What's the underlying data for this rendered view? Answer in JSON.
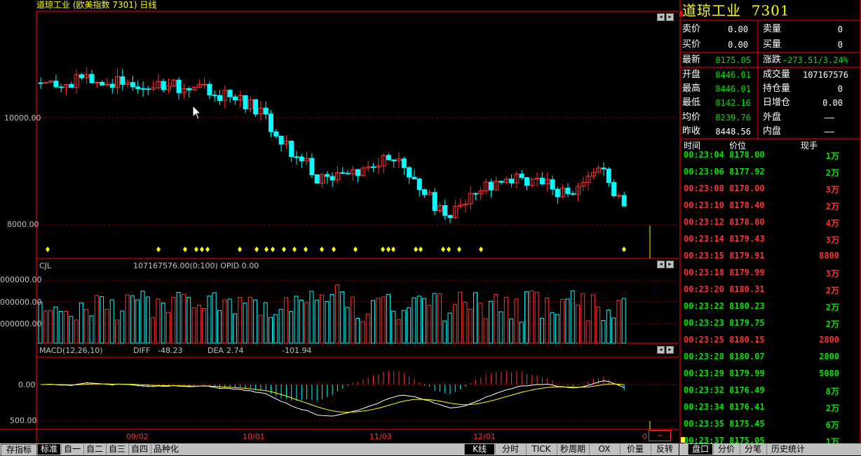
{
  "title": "道琼工业 (欧美指数  7301) 日线",
  "main": {
    "price_labels": [
      "10000.00",
      "8000.00"
    ],
    "date_labels": [
      "09/02",
      "10/01",
      "11/03",
      "12/01",
      "0"
    ]
  },
  "cjl": {
    "label": "CJL",
    "info": "107167576.00(0:100) OPID   0.00",
    "axis_labels": [
      "000000.00",
      "000000.00",
      "000000.00"
    ]
  },
  "macd": {
    "label": "MACD(12,26,10)",
    "diff_label": "DIFF",
    "diff_value": "-48.23",
    "dea_label": "DEA",
    "dea_value": "2.74",
    "macd_value": "-101.94",
    "axis_labels": [
      "0.00",
      "500.00"
    ]
  },
  "quote": {
    "name": "道琼工业",
    "code": "7301",
    "sell_price_label": "卖价",
    "sell_price": "0.00",
    "sell_vol_label": "卖量",
    "sell_vol": "0",
    "buy_price_label": "买价",
    "buy_price": "0.00",
    "buy_vol_label": "买量",
    "buy_vol": "0",
    "last_label": "最新",
    "last": "8175.05",
    "change_label": "涨跌",
    "change": "-273.51/3.24%",
    "open_label": "开盘",
    "open": "8446.01",
    "volume_label": "成交量",
    "volume": "107167576",
    "high_label": "最高",
    "high": "8446.01",
    "oi_label": "持仓量",
    "oi": "0",
    "low_label": "最低",
    "low": "8142.16",
    "daily_inc_label": "日增仓",
    "daily_inc": "0.00",
    "avg_label": "均价",
    "avg": "8239.76",
    "outer_label": "外盘",
    "outer": "——",
    "prev_close_label": "昨收",
    "prev_close": "8448.56",
    "inner_label": "内盘",
    "inner": "——"
  },
  "ticks": {
    "headers": [
      "时间",
      "价位",
      "现手"
    ],
    "rows": [
      {
        "time": "00:23:04",
        "price": "8178.00",
        "vol": "1万",
        "color": "green"
      },
      {
        "time": "00:23:06",
        "price": "8177.92",
        "vol": "2万",
        "color": "green"
      },
      {
        "time": "00:23:08",
        "price": "8178.00",
        "vol": "3万",
        "color": "red"
      },
      {
        "time": "00:23:10",
        "price": "8178.40",
        "vol": "2万",
        "color": "red"
      },
      {
        "time": "00:23:12",
        "price": "8178.80",
        "vol": "4万",
        "color": "red"
      },
      {
        "time": "00:23:14",
        "price": "8179.43",
        "vol": "3万",
        "color": "red"
      },
      {
        "time": "00:23:15",
        "price": "8179.91",
        "vol": "8800",
        "color": "red"
      },
      {
        "time": "00:23:18",
        "price": "8179.99",
        "vol": "3万",
        "color": "red"
      },
      {
        "time": "00:23:20",
        "price": "8180.31",
        "vol": "2万",
        "color": "red"
      },
      {
        "time": "00:23:22",
        "price": "8180.23",
        "vol": "2万",
        "color": "green"
      },
      {
        "time": "00:23:23",
        "price": "8179.75",
        "vol": "2万",
        "color": "green"
      },
      {
        "time": "00:23:25",
        "price": "8180.15",
        "vol": "2800",
        "color": "red"
      },
      {
        "time": "00:23:28",
        "price": "8180.07",
        "vol": "2800",
        "color": "green"
      },
      {
        "time": "00:23:29",
        "price": "8179.99",
        "vol": "5080",
        "color": "green"
      },
      {
        "time": "00:23:32",
        "price": "8176.49",
        "vol": "8万",
        "color": "green"
      },
      {
        "time": "00:23:34",
        "price": "8176.41",
        "vol": "2万",
        "color": "green"
      },
      {
        "time": "00:23:35",
        "price": "8175.45",
        "vol": "6万",
        "color": "green"
      },
      {
        "time": "00:23:37",
        "price": "8175.05",
        "vol": "1万",
        "color": "green"
      }
    ]
  },
  "tabs": {
    "left": [
      "存指标",
      "标准",
      "自一",
      "自二",
      "自三",
      "自四",
      "品种化"
    ],
    "right": [
      "K线",
      "分时",
      "TICK",
      "秒周期",
      "OX",
      "价量",
      "反转"
    ],
    "panel": [
      "盘口",
      "分价",
      "分笔",
      "历史统计"
    ]
  },
  "colors": {
    "up": "#ff3232",
    "down": "#00ffff",
    "grid": "#800000",
    "ma": "#ffff00",
    "diff": "#ffffff"
  }
}
